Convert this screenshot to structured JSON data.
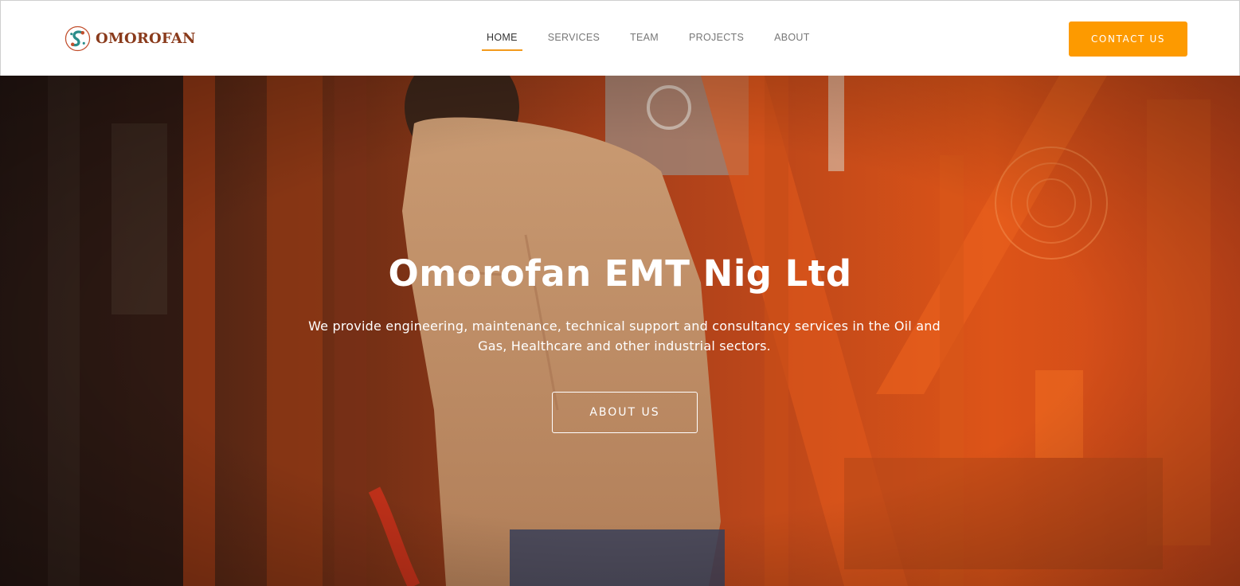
{
  "brand": {
    "name": "OMOROFAN",
    "logo_icon": "omorofan-logo-icon",
    "text_color": "#8a3b1c"
  },
  "nav": {
    "items": [
      {
        "label": "HOME",
        "active": true
      },
      {
        "label": "SERVICES",
        "active": false
      },
      {
        "label": "TEAM",
        "active": false
      },
      {
        "label": "PROJECTS",
        "active": false
      },
      {
        "label": "ABOUT",
        "active": false
      }
    ],
    "active_underline_color": "#f39a1c"
  },
  "header": {
    "contact_label": "CONTACT US",
    "contact_color": "#fd9a00"
  },
  "hero": {
    "title": "Omorofan EMT Nig Ltd",
    "subtitle": "We provide engineering, maintenance, technical support and consultancy services in the Oil and Gas, Healthcare and other industrial sectors.",
    "button_label": "ABOUT US",
    "overlay_color": "#e0531a"
  }
}
